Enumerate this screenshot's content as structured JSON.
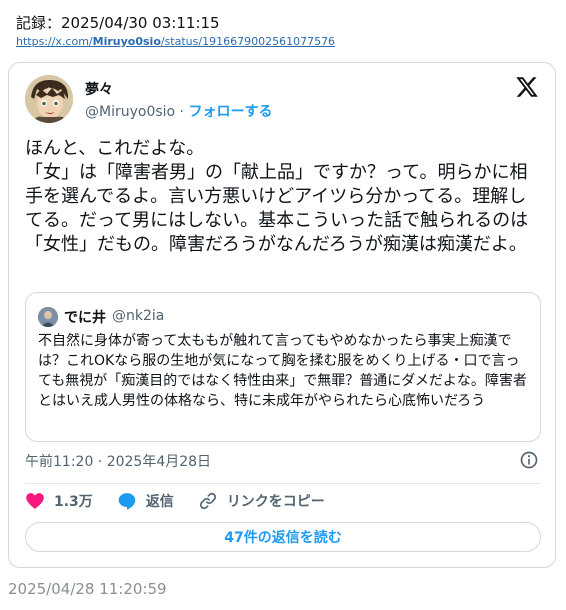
{
  "record": {
    "header": "記録：2025/04/30 03:11:15",
    "url_prefix": "https://x.com/",
    "url_user": "Miruyo0sio",
    "url_suffix": "/status/1916679002561077576",
    "footer": "2025/04/28 11:20:59"
  },
  "tweet": {
    "author_name": "夢々",
    "author_handle": "@Miruyo0sio",
    "separator": " · ",
    "follow_label": "フォローする",
    "text": "ほんと、これだよな。\n「女」は「障害者男」の「献上品」ですか？って。明らかに相手を選んでるよ。言い方悪いけどアイツら分かってる。理解してる。だって男にはしない。基本こういった話で触られるのは「女性」だもの。障害だろうがなんだろうが痴漢は痴漢だよ。",
    "timestamp": "午前11:20 · 2025年4月28日",
    "likes": "1.3万",
    "reply_label": "返信",
    "copy_link_label": "リンクをコピー",
    "read_replies_label": "47件の返信を読む"
  },
  "quote": {
    "author_name": "でに井",
    "author_handle": "@nk2ia",
    "text": "不自然に身体が寄って太ももが触れて言ってもやめなかったら事実上痴漢では？これOKなら服の生地が気になって胸を揉む服をめくり上げる・口で言っても無視が「痴漢目的ではなく特性由来」で無罪？普通にダメだよな。障害者とはいえ成人男性の体格なら、特に未成年がやられたら心底怖いだろう"
  },
  "icons": {
    "logo": "x-logo-icon",
    "info": "info-icon",
    "like": "heart-icon",
    "reply": "reply-bubble-icon",
    "link": "link-icon"
  },
  "colors": {
    "accent": "#1d9bf0",
    "like": "#f91880",
    "muted": "#536471",
    "border": "#cfd9de"
  }
}
